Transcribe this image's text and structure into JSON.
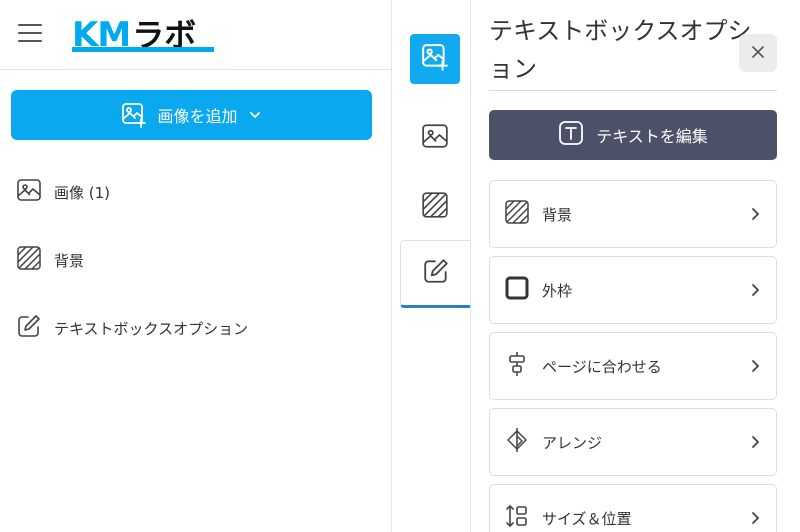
{
  "header": {
    "logo_km": "KM",
    "logo_labo": "ラボ"
  },
  "left_panel": {
    "add_image_label": "画像を追加",
    "items": [
      {
        "label": "画像 (1)",
        "icon": "image-icon"
      },
      {
        "label": "背景",
        "icon": "hatch-icon"
      },
      {
        "label": "テキストボックスオプション",
        "icon": "edit-icon"
      }
    ]
  },
  "right_panel": {
    "title": "テキストボックスオプション",
    "edit_text_label": "テキストを編集",
    "options": [
      {
        "label": "背景",
        "icon": "hatch-icon"
      },
      {
        "label": "外枠",
        "icon": "square-border-icon"
      },
      {
        "label": "ページに合わせる",
        "icon": "align-center-icon"
      },
      {
        "label": "アレンジ",
        "icon": "layers-icon"
      },
      {
        "label": "サイズ＆位置",
        "icon": "resize-vertical-icon"
      }
    ]
  },
  "colors": {
    "accent": "#0aa8ef",
    "edit_button": "#4c5069",
    "active_tab_border": "#2b7fc9"
  }
}
